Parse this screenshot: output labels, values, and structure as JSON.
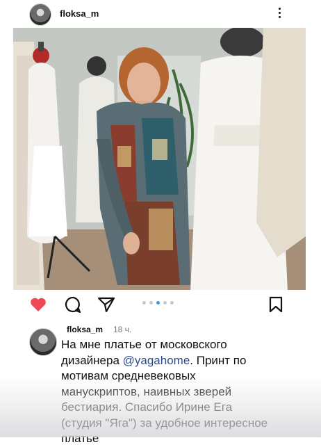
{
  "post": {
    "username": "floksa_m",
    "time": "18 ч.",
    "caption_part1": "На мне платье от московского дизайнера ",
    "mention": "@yagahome",
    "caption_part2": ". Принт по мотивам средневековых манускриптов, наивных зверей бестиария. Спасибо Ирине Ега (студия \"Яга\") за удобное интересное платье"
  },
  "icons": {
    "more": "more-vertical-icon",
    "like": "heart-filled-icon",
    "comment": "comment-bubble-icon",
    "share": "send-paper-plane-icon",
    "save": "bookmark-icon"
  },
  "colors": {
    "like": "#ed4956",
    "mention": "#2a4d8f",
    "pager_active": "#3897f0"
  },
  "carousel": {
    "count": 5,
    "active_index": 2
  }
}
